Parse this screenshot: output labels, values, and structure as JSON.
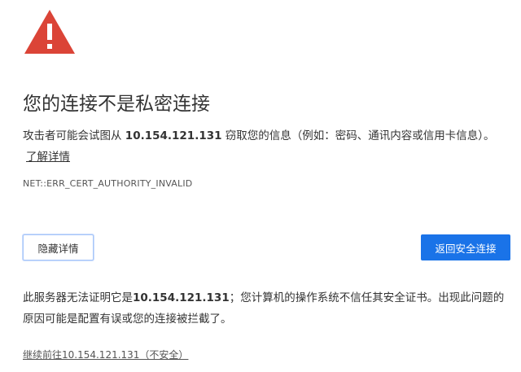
{
  "page": {
    "title": "您的连接不是私密连接",
    "desc_before_host": "攻击者可能会试图从 ",
    "host": "10.154.121.131",
    "desc_after_host": " 窃取您的信息（例如：密码、通讯内容或信用卡信息）。",
    "learn_more": "了解详情",
    "error_code": "NET::ERR_CERT_AUTHORITY_INVALID"
  },
  "buttons": {
    "details_label": "隐藏详情",
    "back_label": "返回安全连接"
  },
  "details": {
    "before_host": "此服务器无法证明它是",
    "host": "10.154.121.131",
    "after_host": "；您计算机的操作系统不信任其安全证书。出现此问题的原因可能是配置有误或您的连接被拦截了。"
  },
  "proceed": {
    "label": "继续前往10.154.121.131（不安全）"
  },
  "colors": {
    "warning_red": "#db4437",
    "primary_blue": "#1a73e8"
  }
}
